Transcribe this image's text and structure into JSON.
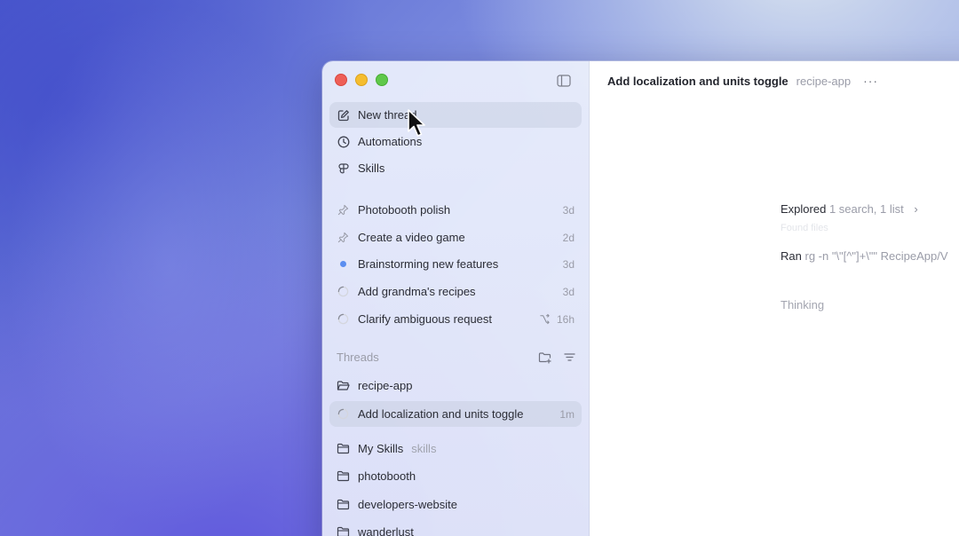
{
  "sidebar": {
    "actions": [
      {
        "label": "New thread",
        "icon": "compose-icon"
      },
      {
        "label": "Automations",
        "icon": "clock-icon"
      },
      {
        "label": "Skills",
        "icon": "skills-icon"
      }
    ],
    "pinned": [
      {
        "label": "Photobooth polish",
        "meta": "3d",
        "icon": "pin-icon"
      },
      {
        "label": "Create a video game",
        "meta": "2d",
        "icon": "pin-icon"
      },
      {
        "label": "Brainstorming new features",
        "meta": "3d",
        "icon": "unread-dot"
      },
      {
        "label": "Add grandma's recipes",
        "meta": "3d",
        "icon": "spinner-icon"
      },
      {
        "label": "Clarify ambiguous request",
        "meta": "16h",
        "icon": "spinner-icon"
      }
    ],
    "threads_header": "Threads",
    "projects": [
      {
        "label": "recipe-app",
        "icon": "folder-open-icon"
      },
      {
        "label": "Add localization and units toggle",
        "meta": "1m",
        "icon": "spinner-icon"
      },
      {
        "label": "My Skills",
        "secondary": "skills",
        "icon": "folder-icon"
      },
      {
        "label": "photobooth",
        "icon": "folder-icon"
      },
      {
        "label": "developers-website",
        "icon": "folder-icon"
      },
      {
        "label": "wanderlust",
        "icon": "folder-icon"
      }
    ]
  },
  "main": {
    "title": "Add localization and units toggle",
    "project": "recipe-app",
    "more": "···",
    "explored_verb": "Explored",
    "explored_detail": "1 search, 1 list",
    "chevron": "›",
    "faded_text": "Found files",
    "ran_verb": "Ran",
    "ran_detail": "rg -n \"\\\"[^\"]+\\\"\" RecipeApp/V",
    "thinking": "Thinking"
  }
}
